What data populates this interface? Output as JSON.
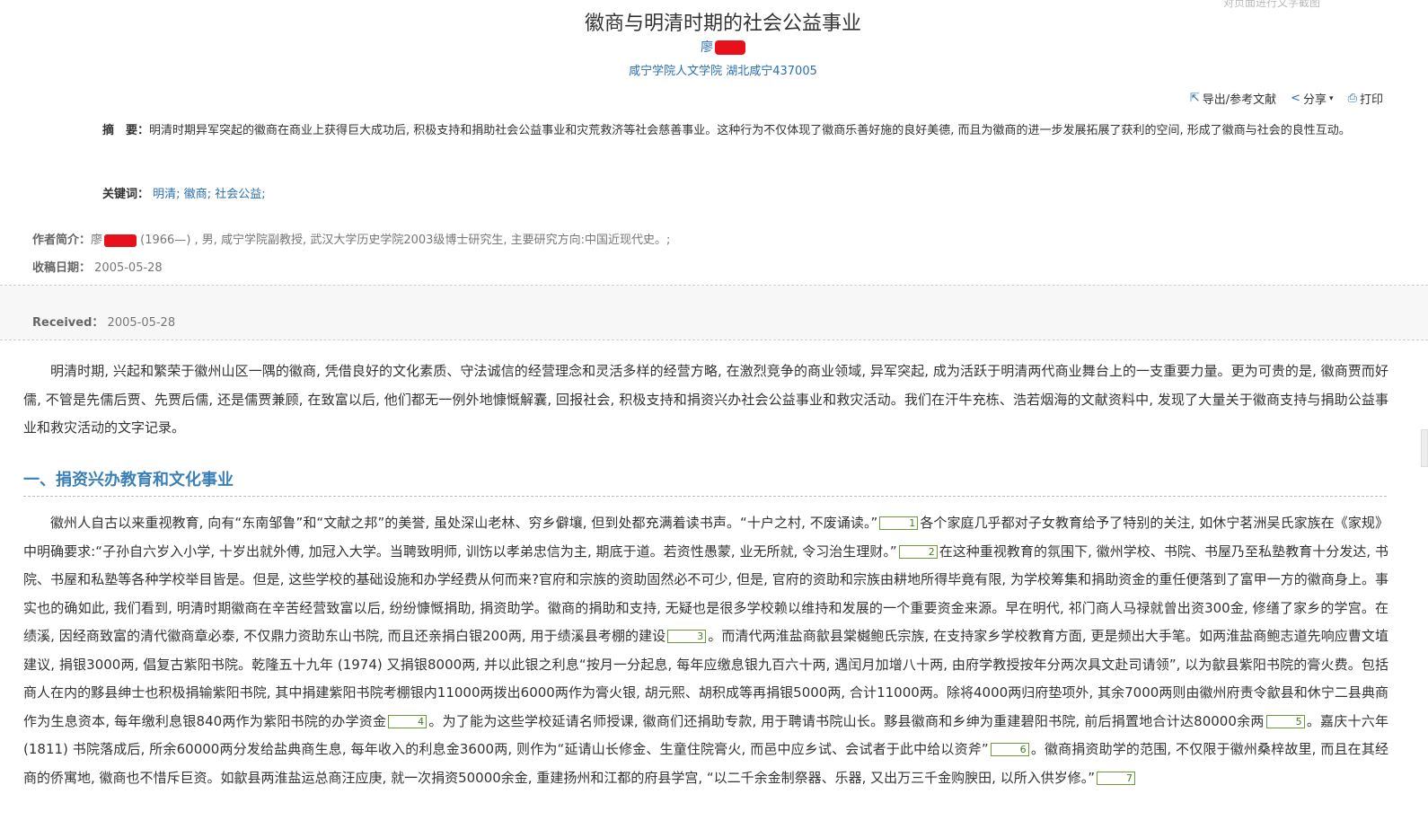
{
  "header": {
    "title": "徽商与明清时期的社会公益事业",
    "author": "廖",
    "affiliation": "咸宁学院人文学院 湖北咸宁437005",
    "faint_top": "对页面进行文字截图"
  },
  "tools": {
    "export": "导出/参考文献",
    "share": "分享",
    "print": "打印"
  },
  "abstract": {
    "label": "摘　要：",
    "text": "明清时期异军突起的徽商在商业上获得巨大成功后, 积极支持和捐助社会公益事业和灾荒救济等社会慈善事业。这种行为不仅体现了徽商乐善好施的良好美德, 而且为徽商的进一步发展拓展了获利的空间, 形成了徽商与社会的良性互动。"
  },
  "keywords": {
    "label": "关键词：",
    "items": [
      "明清;",
      "徽商;",
      "社会公益;"
    ]
  },
  "author_info": {
    "label": "作者简介：",
    "name": "廖",
    "text": "(1966—) , 男, 咸宁学院副教授, 武汉大学历史学院2003级博士研究生, 主要研究方向:中国近现代史。;"
  },
  "received_cn": {
    "label": "收稿日期：",
    "value": "2005-05-28"
  },
  "received_en": {
    "label": "Received：",
    "value": "2005-05-28"
  },
  "body": {
    "para1": "明清时期, 兴起和繁荣于徽州山区一隅的徽商, 凭借良好的文化素质、守法诚信的经营理念和灵活多样的经营方略, 在激烈竞争的商业领域, 异军突起, 成为活跃于明清两代商业舞台上的一支重要力量。更为可贵的是, 徽商贾而好儒, 不管是先儒后贾、先贾后儒, 还是儒贾兼顾, 在致富以后, 他们都无一例外地慷慨解囊, 回报社会, 积极支持和捐资兴办社会公益事业和救灾活动。我们在汗牛充栋、浩若烟海的文献资料中, 发现了大量关于徽商支持与捐助公益事业和救灾活动的文字记录。",
    "heading1": "一、捐资兴办教育和文化事业",
    "p2_s1": "徽州人自古以来重视教育, 向有“东南邹鲁”和“文献之邦”的美誉, 虽处深山老林、穷乡僻壤, 但到处都充满着读书声。“十户之村, 不废诵读。”",
    "p2_s2": "各个家庭几乎都对子女教育给予了特别的关注, 如休宁茗洲吴氏家族在《家规》中明确要求:“子孙自六岁入小学, 十岁出就外傅, 加冠入大学。当聘致明师, 训饬以孝弟忠信为主, 期底于道。若资性愚蒙, 业无所就, 令习治生理财。”",
    "p2_s3": "在这种重视教育的氛围下, 徽州学校、书院、书屋乃至私塾教育十分发达, 书院、书屋和私塾等各种学校举目皆是。但是, 这些学校的基础设施和办学经费从何而来?官府和宗族的资助固然必不可少, 但是, 官府的资助和宗族由耕地所得毕竟有限, 为学校筹集和捐助资金的重任便落到了富甲一方的徽商身上。事实也的确如此, 我们看到, 明清时期徽商在辛苦经营致富以后, 纷纷慷慨捐助, 捐资助学。徽商的捐助和支持, 无疑也是很多学校赖以维持和发展的一个重要资金来源。早在明代, 祁门商人马禄就曾出资300金, 修缮了家乡的学宫。在绩溪, 因经商致富的清代徽商章必泰, 不仅鼎力资助东山书院, 而且还亲捐白银200两, 用于绩溪县考棚的建设",
    "p2_s4": "。而清代两淮盐商歙县棠樾鲍氏宗族, 在支持家乡学校教育方面, 更是频出大手笔。如两淮盐商鲍志道先响应曹文埴建议, 捐银3000两, 倡复古紫阳书院。乾隆五十九年 (1974) 又捐银8000两, 并以此银之利息“按月一分起息, 每年应缴息银九百六十两, 遇闰月加增八十两, 由府学教授按年分两次具文赴司请领”, 以为歙县紫阳书院的膏火费。包括商人在内的黟县绅士也积极捐输紫阳书院, 其中捐建紫阳书院考棚银内11000两拨出6000两作为膏火银, 胡元熙、胡积成等再捐银5000两, 合计11000两。除将4000两归府垫项外, 其余7000两则由徽州府责令歙县和休宁二县典商作为生息资本, 每年缴利息银840两作为紫阳书院的办学资金",
    "p2_s5": "。为了能为这些学校延请名师授课, 徽商们还捐助专款, 用于聘请书院山长。黟县徽商和乡绅为重建碧阳书院, 前后捐置地合计达80000余两",
    "p2_s6": "。嘉庆十六年 (1811) 书院落成后, 所余60000两分发给盐典商生息, 每年收入的利息金3600两, 则作为“延请山长修金、生童住院膏火, 而邑中应乡试、会试者于此中给以资斧”",
    "p2_s7": "。徽商捐资助学的范围, 不仅限于徽州桑梓故里, 而且在其经商的侨寓地, 徽商也不惜斥巨资。如歙县两淮盐运总商汪应庚, 就一次捐资50000余金, 重建扬州和江都的府县学宫, “以二千余金制祭器、乐器, 又出万三千金购腴田, 以所入供岁修。”",
    "refs": [
      "1",
      "2",
      "3",
      "4",
      "5",
      "6",
      "7"
    ]
  }
}
